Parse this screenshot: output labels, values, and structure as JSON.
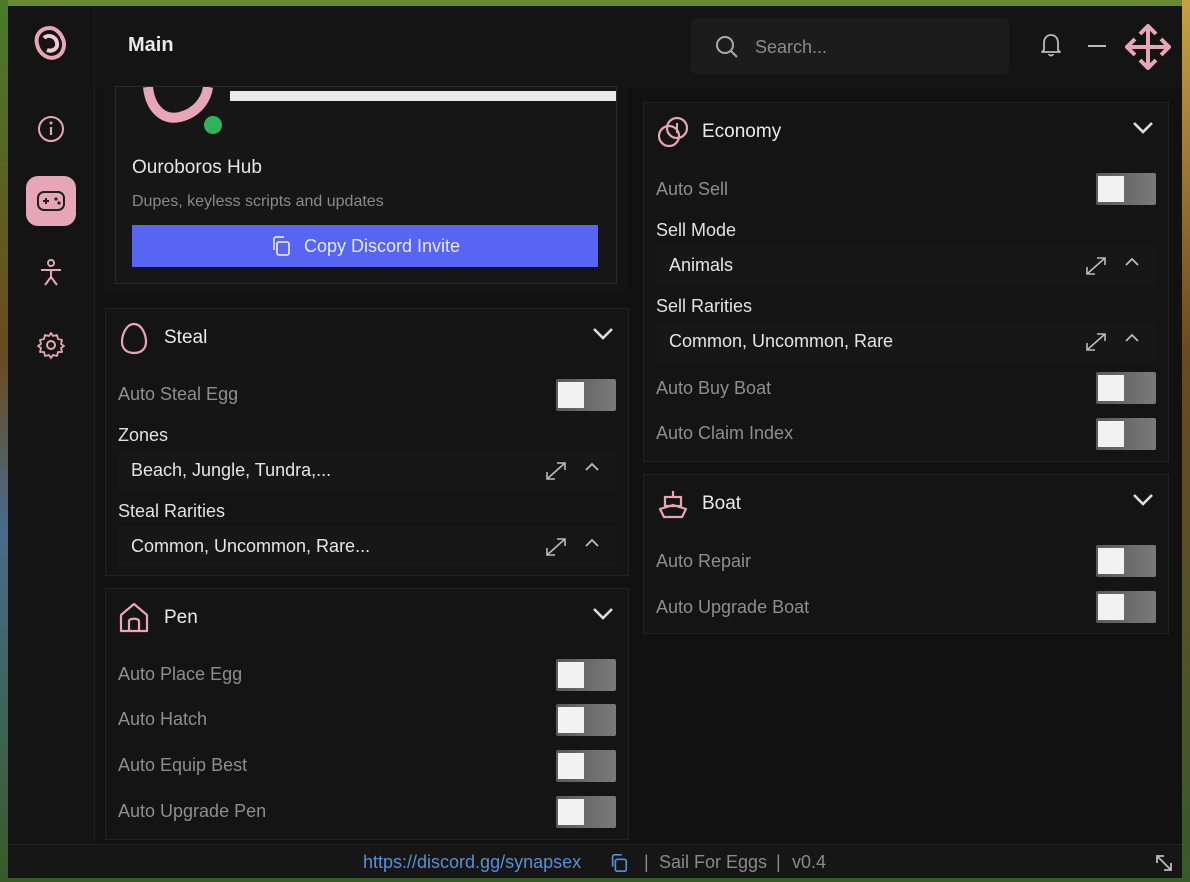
{
  "window": {
    "title": "Main"
  },
  "search": {
    "placeholder": "Search..."
  },
  "colors": {
    "accent": "#e7a6b8",
    "discord_button": "#5865f2",
    "link": "#5b8fd6",
    "online": "#2fb35a"
  },
  "sidebar": {
    "items": [
      {
        "name": "info",
        "icon": "info-icon"
      },
      {
        "name": "game",
        "icon": "gamepad-icon",
        "active": true
      },
      {
        "name": "player",
        "icon": "person-icon"
      },
      {
        "name": "settings",
        "icon": "gear-icon"
      }
    ]
  },
  "discord": {
    "name": "Ouroboros Hub",
    "description": "Dupes, keyless scripts and updates",
    "button_label": "Copy Discord Invite",
    "status": "online"
  },
  "steal": {
    "title": "Steal",
    "auto_steal_egg": {
      "label": "Auto Steal Egg",
      "on": false
    },
    "zones": {
      "label": "Zones",
      "value": "Beach, Jungle, Tundra,..."
    },
    "rarities": {
      "label": "Steal Rarities",
      "value": "Common, Uncommon, Rare..."
    }
  },
  "pen": {
    "title": "Pen",
    "toggles": [
      {
        "label": "Auto Place Egg",
        "on": false
      },
      {
        "label": "Auto Hatch",
        "on": false
      },
      {
        "label": "Auto Equip Best",
        "on": false
      },
      {
        "label": "Auto Upgrade Pen",
        "on": false
      }
    ]
  },
  "economy": {
    "title": "Economy",
    "auto_sell": {
      "label": "Auto Sell",
      "on": false
    },
    "sell_mode": {
      "label": "Sell Mode",
      "value": "Animals"
    },
    "sell_rarities": {
      "label": "Sell Rarities",
      "value": "Common, Uncommon, Rare"
    },
    "auto_buy_boat": {
      "label": "Auto Buy Boat",
      "on": false
    },
    "auto_claim_index": {
      "label": "Auto Claim Index",
      "on": false
    }
  },
  "boat": {
    "title": "Boat",
    "toggles": [
      {
        "label": "Auto Repair",
        "on": false
      },
      {
        "label": "Auto Upgrade Boat",
        "on": false
      }
    ]
  },
  "footer": {
    "link": "https://discord.gg/synapsex",
    "separator": "|",
    "game": "Sail For Eggs",
    "version": "v0.4"
  }
}
